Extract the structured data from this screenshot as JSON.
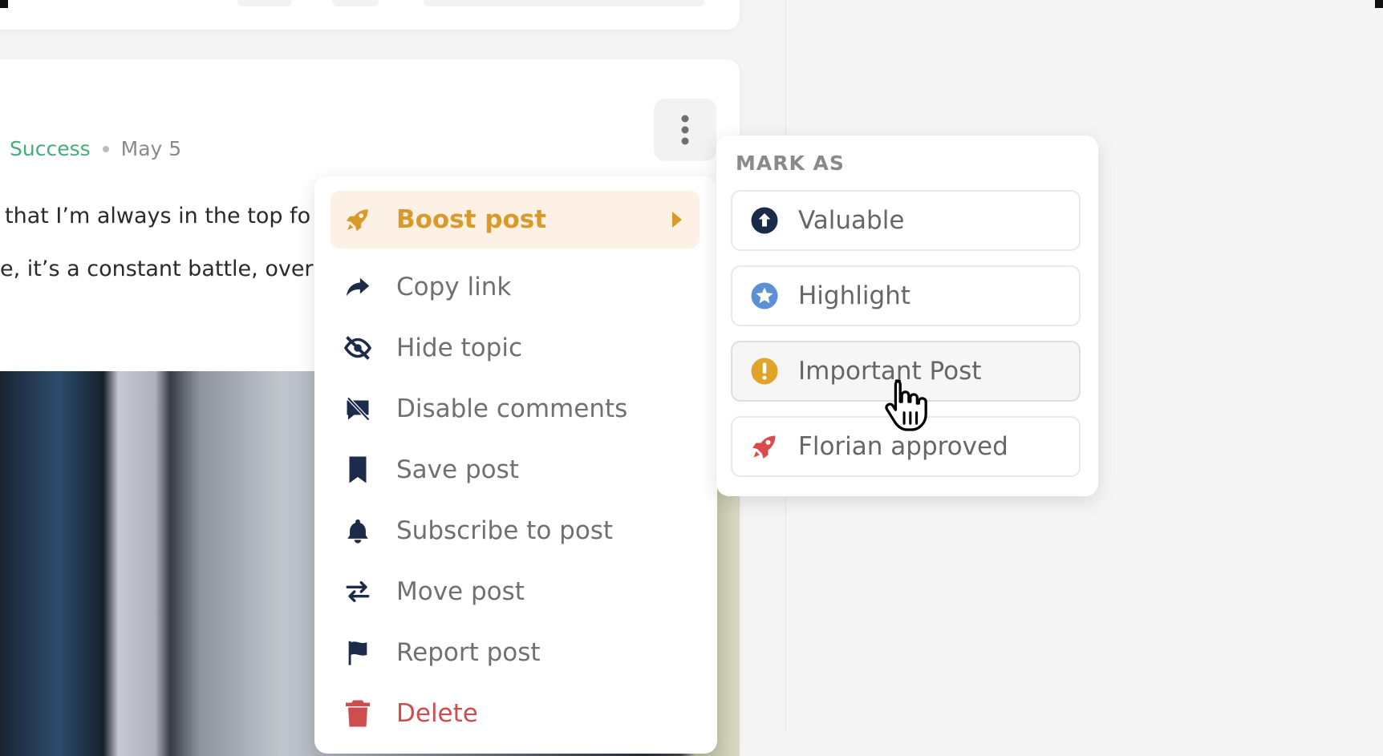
{
  "post": {
    "category": "Success",
    "date": "May 5",
    "line1": "that I’m always in the top fo",
    "line2": "e, it’s a constant battle, over"
  },
  "menu": {
    "more_icon": "more-vertical-icon",
    "items": [
      {
        "label": "Boost post",
        "icon": "rocket-icon"
      },
      {
        "label": "Copy link",
        "icon": "share-arrow-icon"
      },
      {
        "label": "Hide topic",
        "icon": "eye-slash-icon"
      },
      {
        "label": "Disable comments",
        "icon": "comment-slash-icon"
      },
      {
        "label": "Save post",
        "icon": "bookmark-icon"
      },
      {
        "label": "Subscribe to post",
        "icon": "bell-icon"
      },
      {
        "label": "Move post",
        "icon": "arrows-swap-icon"
      },
      {
        "label": "Report post",
        "icon": "flag-icon"
      },
      {
        "label": "Delete",
        "icon": "trash-icon"
      }
    ]
  },
  "mark_as": {
    "heading": "MARK AS",
    "options": [
      {
        "label": "Valuable",
        "icon": "arrow-up-circle-icon",
        "color": "#1a2a4a"
      },
      {
        "label": "Highlight",
        "icon": "star-circle-icon",
        "color": "#5b8fd6"
      },
      {
        "label": "Important Post",
        "icon": "exclamation-circle-icon",
        "color": "#e0a528"
      },
      {
        "label": "Florian approved",
        "icon": "rocket-icon",
        "color": "#d94c4c"
      }
    ]
  },
  "colors": {
    "accent_boost": "#d99a2b",
    "danger": "#cc4e4e",
    "success": "#3fae78",
    "icon_dark": "#1c2b4a"
  }
}
